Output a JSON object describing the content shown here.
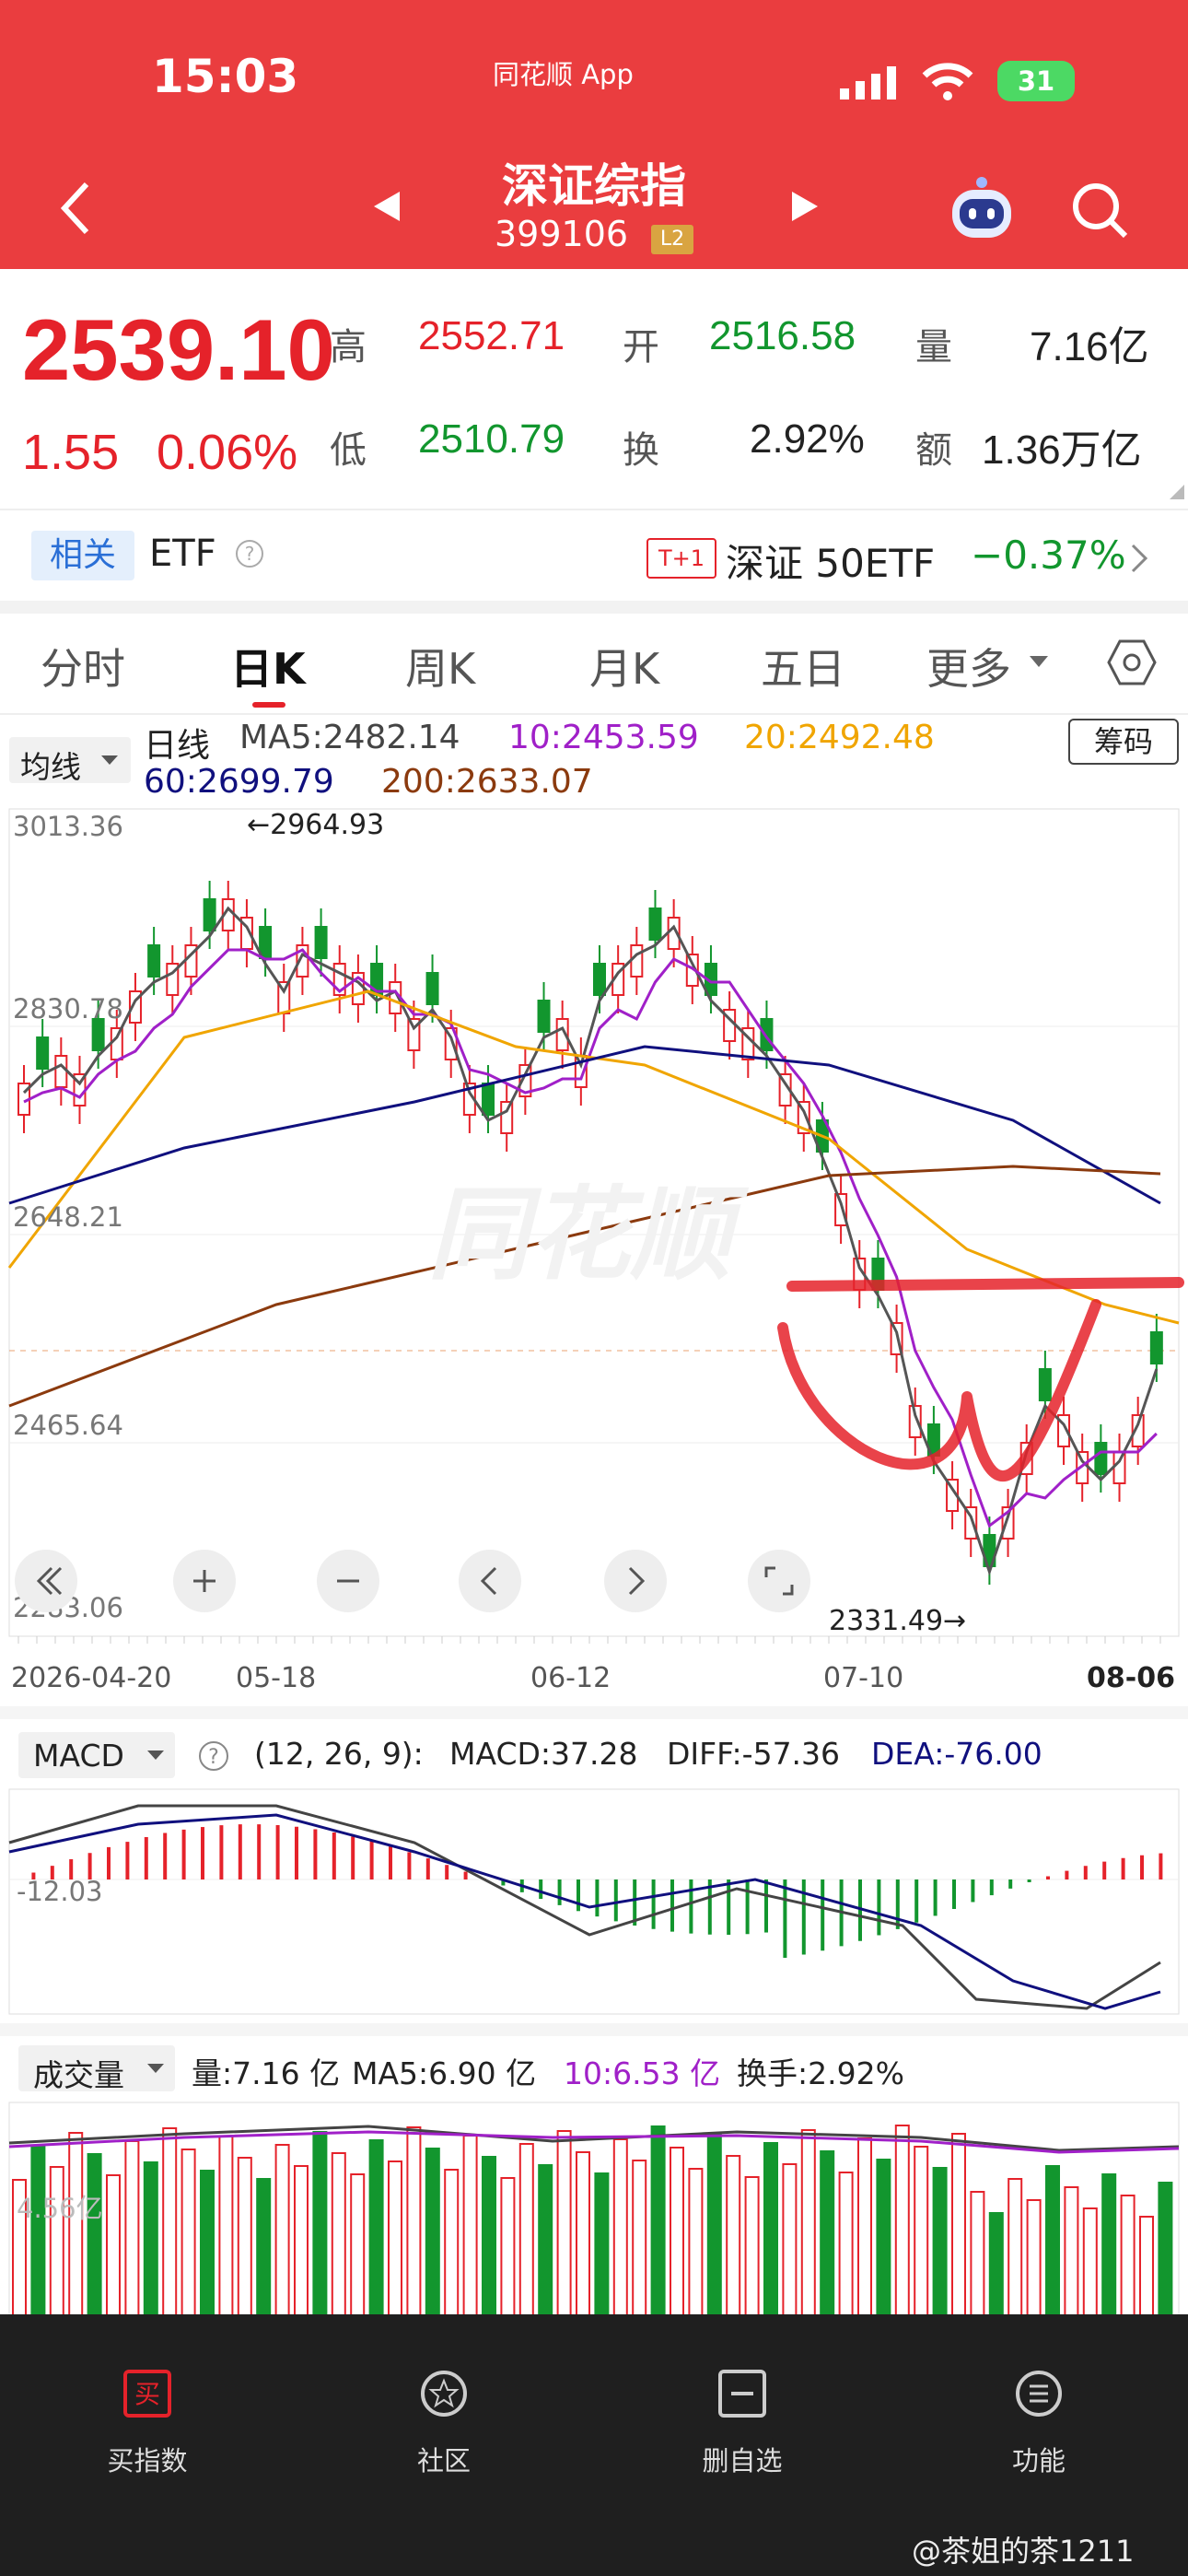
{
  "status_bar": {
    "time": "15:03",
    "app_back": "同花顺 App",
    "battery": "31"
  },
  "header": {
    "title": "深证综指",
    "code": "399106",
    "level_badge": "L2"
  },
  "quote": {
    "price": "2539.10",
    "change": "1.55",
    "change_pct": "0.06%",
    "high_label": "高",
    "high": "2552.71",
    "open_label": "开",
    "open": "2516.58",
    "volume_label": "量",
    "volume": "7.16亿",
    "low_label": "低",
    "low": "2510.79",
    "turnover_label": "换",
    "turnover": "2.92%",
    "amount_label": "额",
    "amount": "1.36万亿"
  },
  "etf_row": {
    "related": "相关",
    "etf": "ETF",
    "t1": "T+1",
    "etf_name": "深证 50ETF",
    "etf_change": "−0.37%"
  },
  "tabs": [
    "分时",
    "日K",
    "周K",
    "月K",
    "五日",
    "更多"
  ],
  "ma_bar": {
    "selector": "均线",
    "period": "日线",
    "ma5": "MA5:2482.14",
    "ma10": "10:2453.59",
    "ma20": "20:2492.48",
    "ma60": "60:2699.79",
    "ma200": "200:2633.07",
    "chips_button": "筹码"
  },
  "kline": {
    "y_ticks": [
      "3013.36",
      "2830.78",
      "2648.21",
      "2465.64",
      "2283.06"
    ],
    "max_mark": "←2964.93",
    "min_mark": "2331.49→",
    "dates": [
      "2026-04-20",
      "05-18",
      "06-12",
      "07-10",
      "08-06"
    ],
    "watermark": "同花顺"
  },
  "macd": {
    "selector": "MACD",
    "params": "(12, 26, 9):",
    "macd": "MACD:37.28",
    "diff": "DIFF:-57.36",
    "dea": "DEA:-76.00",
    "y_tick": "-12.03"
  },
  "volume_panel": {
    "selector": "成交量",
    "vol": "量:7.16 亿",
    "ma5": "MA5:6.90 亿",
    "ma10": "10:6.53 亿",
    "turnover": "换手:2.92%",
    "y_tick": "4.56亿"
  },
  "bottom_nav": [
    "买指数",
    "社区",
    "删自选",
    "功能"
  ],
  "watermark_user": "@茶姐的茶1211",
  "colors": {
    "brand_red": "#ea3d3f",
    "up": "#e5222a",
    "down": "#12962e",
    "ma5": "#555555",
    "ma10": "#a020c8",
    "ma20": "#f0a500",
    "ma60": "#10107e",
    "ma200": "#8b3a0e"
  }
}
